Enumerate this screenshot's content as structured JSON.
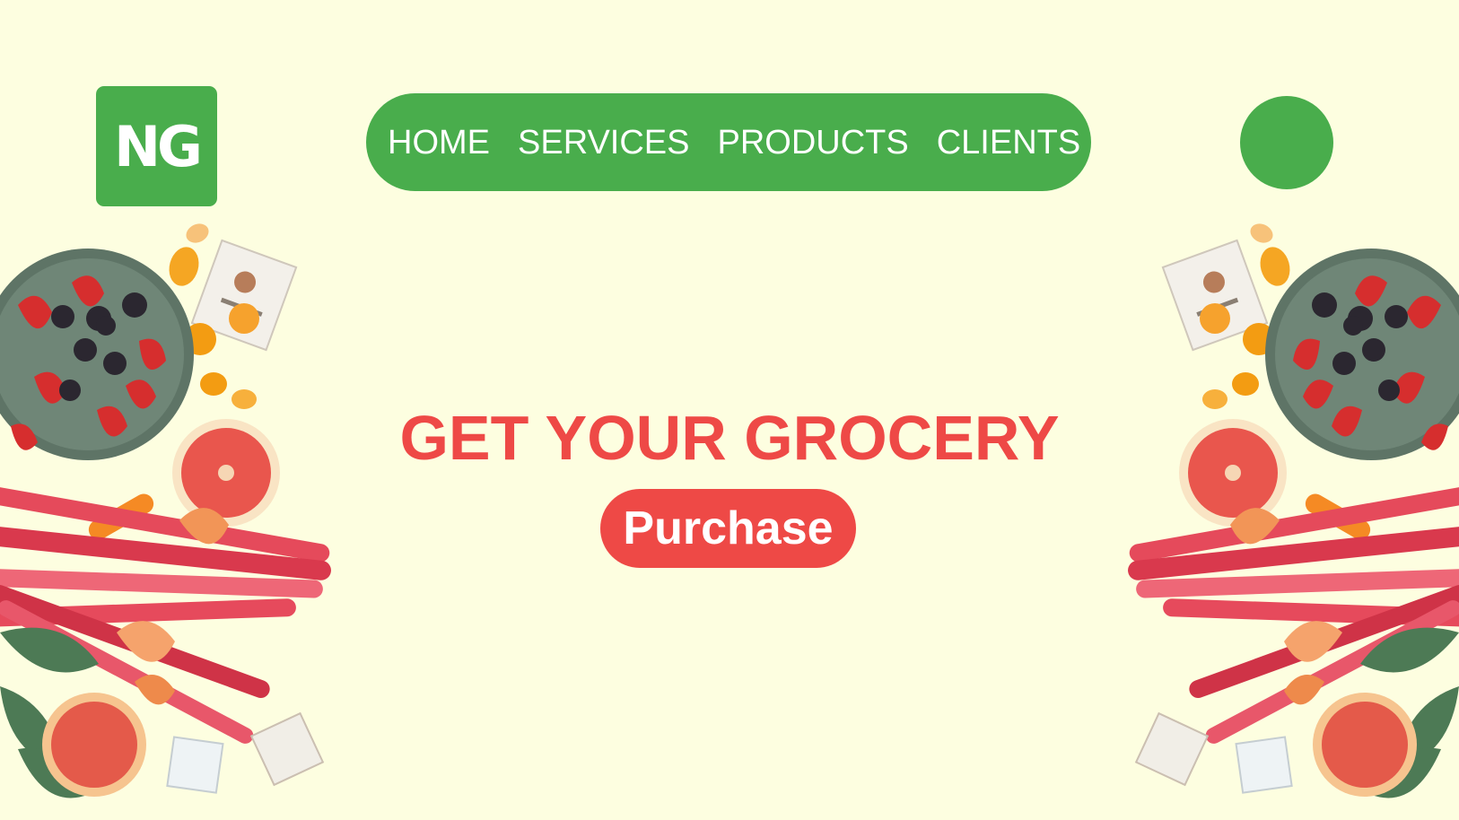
{
  "colors": {
    "background": "#fdfee0",
    "brand_green": "#49ad4c",
    "accent_red": "#ee4946",
    "white": "#ffffff"
  },
  "logo": {
    "text": "NG"
  },
  "nav": {
    "items": [
      {
        "label": "HOME"
      },
      {
        "label": "SERVICES"
      },
      {
        "label": "PRODUCTS"
      },
      {
        "label": "CLIENTS"
      }
    ]
  },
  "hero": {
    "headline": "GET YOUR GROCERY",
    "cta_label": "Purchase"
  },
  "decorations": {
    "left_image": "fruit-vegetable-arrangement",
    "right_image": "fruit-vegetable-arrangement-mirrored"
  }
}
